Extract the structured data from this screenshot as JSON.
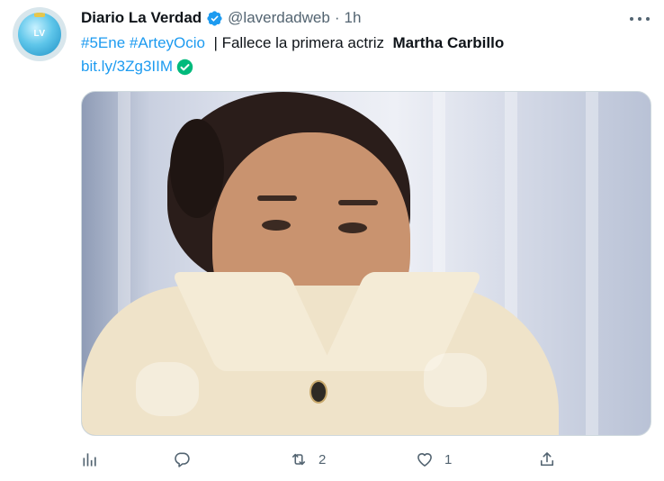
{
  "tweet": {
    "display_name": "Diario La Verdad",
    "handle": "@laverdadweb",
    "separator": "·",
    "time": "1h",
    "hashtag1": "#5Ene",
    "hashtag2": "#ArteyOcio",
    "text_mid": " | Fallece la primera actriz ",
    "text_bold": "Martha Carbillo",
    "link": "bit.ly/3Zg3IIM",
    "avatar_logo": "LV",
    "media_alt": "Photo of actress"
  },
  "actions": {
    "retweet_count": "2",
    "like_count": "1"
  },
  "icons": {
    "verified": "verified-badge-icon",
    "link_check": "check-circle-icon",
    "more": "more-horizontal-icon",
    "analytics": "analytics-icon",
    "reply": "reply-icon",
    "retweet": "retweet-icon",
    "like": "heart-icon",
    "share": "share-icon"
  },
  "colors": {
    "accent": "#1d9bf0",
    "muted": "#536471",
    "check_green": "#00ba7c"
  }
}
